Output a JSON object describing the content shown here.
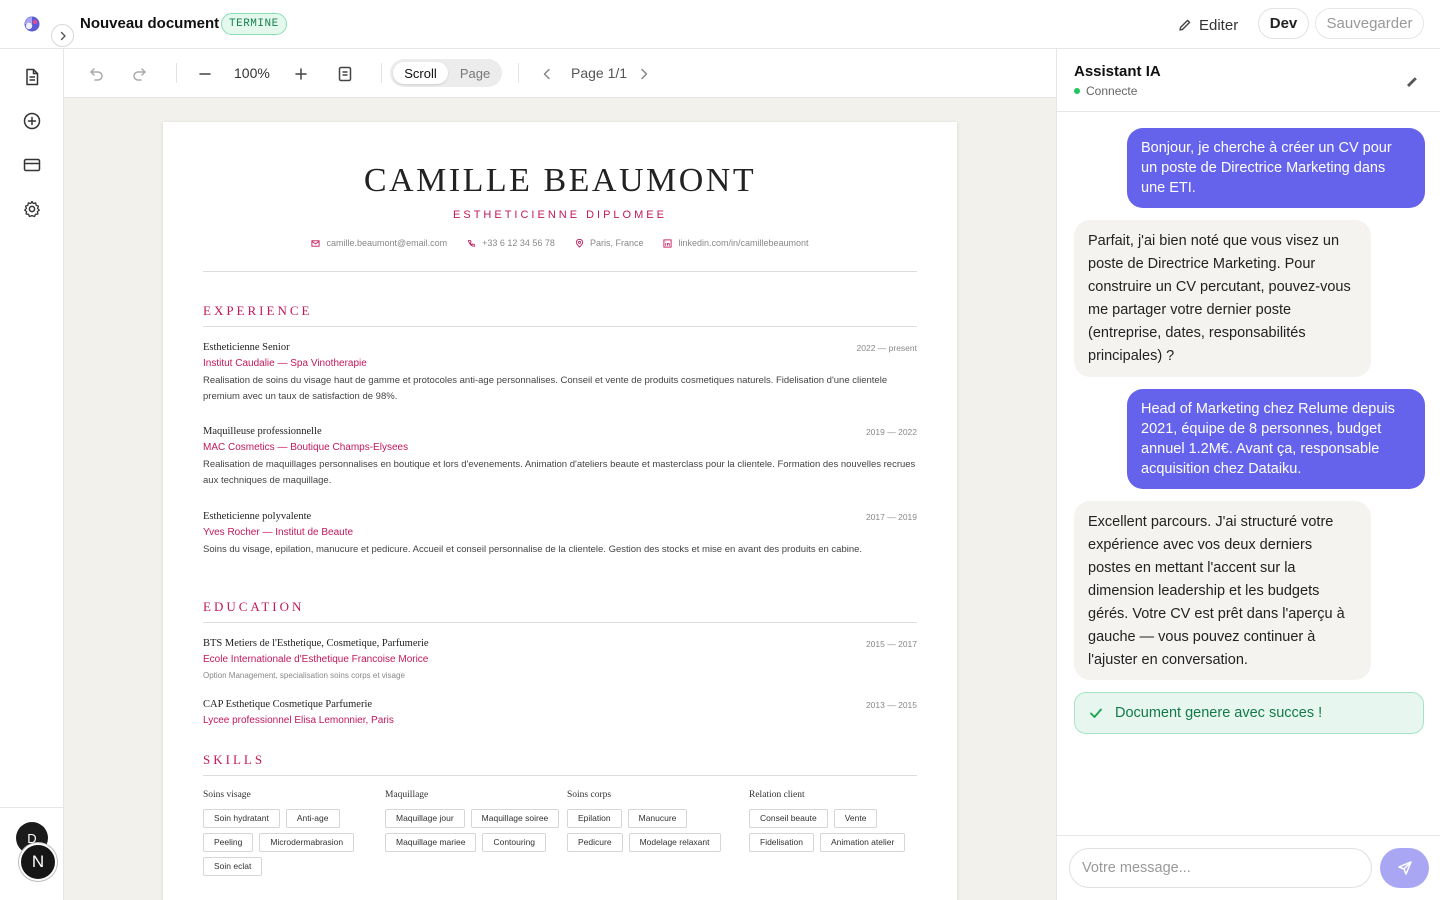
{
  "header": {
    "title": "Nouveau document",
    "status": "TERMINE",
    "edit_label": "Editer",
    "dev_label": "Dev",
    "save_label": "Sauvegarder"
  },
  "toolbar": {
    "zoom": "100%",
    "scroll_label": "Scroll",
    "page_label": "Page",
    "page_indicator": "Page 1/1"
  },
  "cv": {
    "name": "CAMILLE BEAUMONT",
    "title": "ESTHETICIENNE DIPLOMEE",
    "contact": {
      "email": "camille.beaumont@email.com",
      "phone": "+33 6 12 34 56 78",
      "location": "Paris, France",
      "linkedin": "linkedin.com/in/camillebeaumont"
    },
    "experience_title": "EXPERIENCE",
    "experience": [
      {
        "title": "Estheticienne Senior",
        "company": "Institut Caudalie — Spa Vinotherapie",
        "dates": "2022 — present",
        "desc": "Realisation de soins du visage haut de gamme et protocoles anti-age personnalises. Conseil et vente de produits cosmetiques naturels. Fidelisation d'une clientele premium avec un taux de satisfaction de 98%."
      },
      {
        "title": "Maquilleuse professionnelle",
        "company": "MAC Cosmetics — Boutique Champs-Elysees",
        "dates": "2019 — 2022",
        "desc": "Realisation de maquillages personnalises en boutique et lors d'evenements. Animation d'ateliers beaute et masterclass pour la clientele. Formation des nouvelles recrues aux techniques de maquillage."
      },
      {
        "title": "Estheticienne polyvalente",
        "company": "Yves Rocher — Institut de Beaute",
        "dates": "2017 — 2019",
        "desc": "Soins du visage, epilation, manucure et pedicure. Accueil et conseil personnalise de la clientele. Gestion des stocks et mise en avant des produits en cabine."
      }
    ],
    "education_title": "EDUCATION",
    "education": [
      {
        "title": "BTS Metiers de l'Esthetique, Cosmetique, Parfumerie",
        "school": "Ecole Internationale d'Esthetique Francoise Morice",
        "dates": "2015 — 2017",
        "note": "Option Management, specialisation soins corps et visage"
      },
      {
        "title": "CAP Esthetique Cosmetique Parfumerie",
        "school": "Lycee professionnel Elisa Lemonnier, Paris",
        "dates": "2013 — 2015",
        "note": ""
      }
    ],
    "skills_title": "SKILLS",
    "skills": [
      {
        "category": "Soins visage",
        "items": [
          "Soin hydratant",
          "Anti-age",
          "Peeling",
          "Microdermabrasion",
          "Soin eclat"
        ]
      },
      {
        "category": "Maquillage",
        "items": [
          "Maquillage jour",
          "Maquillage soiree",
          "Maquillage mariee",
          "Contouring"
        ]
      },
      {
        "category": "Soins corps",
        "items": [
          "Epilation",
          "Manucure",
          "Pedicure",
          "Modelage relaxant"
        ]
      },
      {
        "category": "Relation client",
        "items": [
          "Conseil beaute",
          "Vente",
          "Fidelisation",
          "Animation atelier"
        ]
      }
    ]
  },
  "assistant": {
    "title": "Assistant IA",
    "status": "Connecte",
    "messages": [
      {
        "role": "user",
        "text": "Bonjour, je cherche à créer un CV pour un poste de Directrice Marketing dans une ETI."
      },
      {
        "role": "assistant",
        "text": "Parfait, j'ai bien noté que vous visez un poste de Directrice Marketing. Pour construire un CV percutant, pouvez-vous me partager votre dernier poste (entreprise, dates, responsabilités principales) ?"
      },
      {
        "role": "user",
        "text": "Head of Marketing chez Relume depuis 2021, équipe de 8 personnes, budget annuel 1.2M€. Avant ça, responsable acquisition chez Dataiku."
      },
      {
        "role": "assistant",
        "text": "Excellent parcours. J'ai structuré votre expérience avec vos deux derniers postes en mettant l'accent sur la dimension leadership et les budgets gérés. Votre CV est prêt dans l'aperçu à gauche — vous pouvez continuer à l'ajuster en conversation."
      }
    ],
    "success_text": "Document genere avec succes !",
    "input_placeholder": "Votre message..."
  },
  "user": {
    "avatar_d": "D",
    "avatar_n": "N"
  },
  "colors": {
    "accent": "#c2185b",
    "chat_user": "#6563eb",
    "success": "#137a47"
  }
}
